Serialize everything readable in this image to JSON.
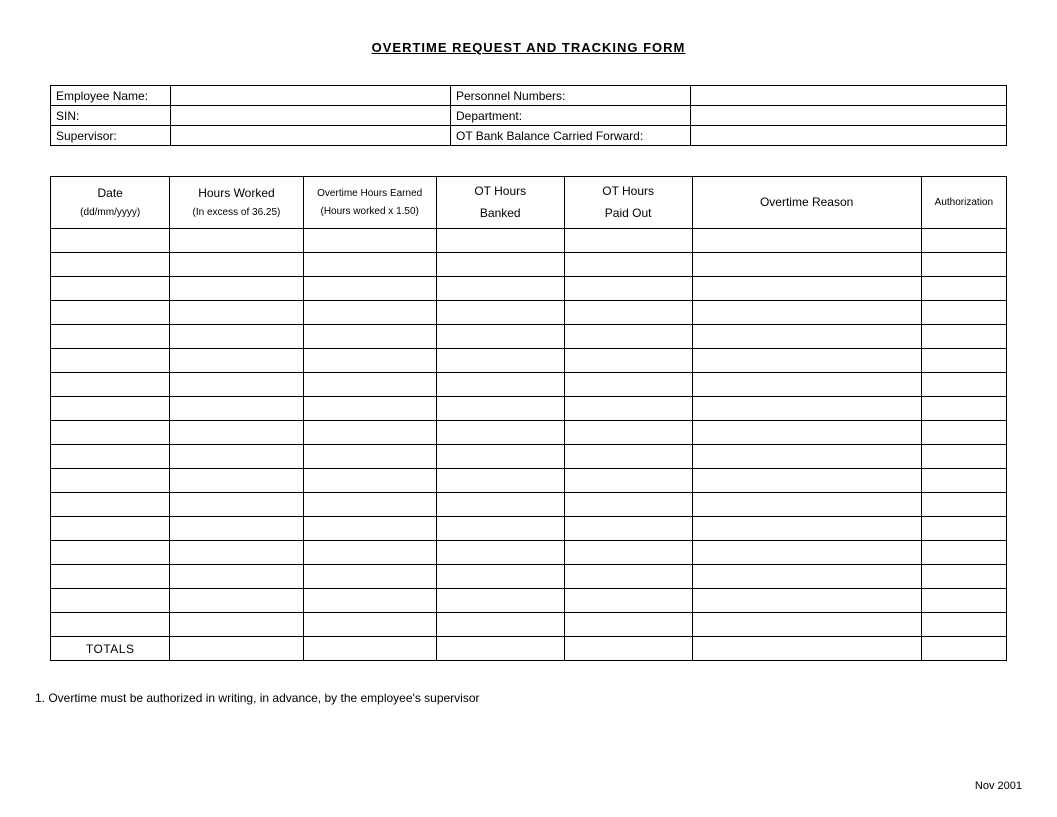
{
  "title": "OVERTIME  REQUEST  AND  TRACKING  FORM",
  "info": {
    "employee_name_label": "Employee Name:",
    "employee_name_value": "",
    "personnel_numbers_label": "Personnel Numbers:",
    "personnel_numbers_value": "",
    "sin_label": "SIN:",
    "sin_value": "",
    "department_label": "Department:",
    "department_value": "",
    "supervisor_label": "Supervisor:",
    "supervisor_value": "",
    "ot_bank_label": "OT Bank Balance Carried Forward:",
    "ot_bank_value": ""
  },
  "columns": {
    "date": "Date",
    "date_sub": "(dd/mm/yyyy)",
    "hours_worked": "Hours Worked",
    "hours_worked_sub": "(In excess of 36.25)",
    "ot_earned": "Overtime Hours Earned",
    "ot_earned_sub": "(Hours worked x 1.50)",
    "ot_banked": "OT Hours",
    "ot_banked_sub": "Banked",
    "ot_paid": "OT Hours",
    "ot_paid_sub": "Paid Out",
    "reason": "Overtime Reason",
    "auth": "Authorization"
  },
  "totals_label": "TOTALS",
  "note": "1. Overtime must be authorized in writing, in advance, by the employee's supervisor",
  "footer_date": "Nov 2001"
}
